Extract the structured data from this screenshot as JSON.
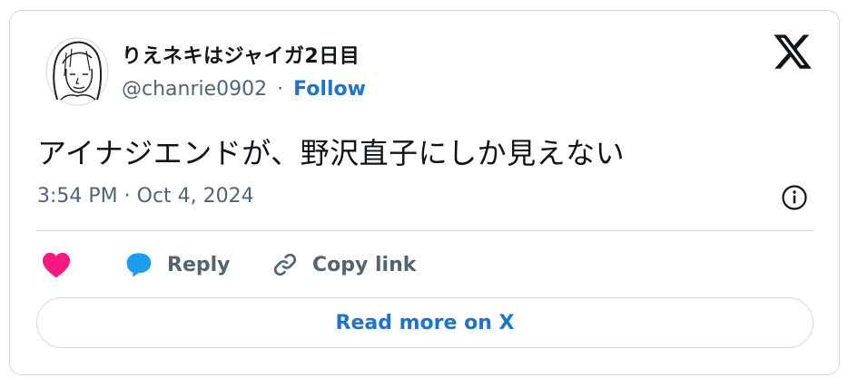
{
  "author": {
    "display_name": "りえネキはジャイガ2日目",
    "handle": "@chanrie0902",
    "separator": "·",
    "follow_label": "Follow",
    "avatar_icon": "sketch-portrait-avatar"
  },
  "logo_icon": "x-logo-icon",
  "tweet": {
    "text": "アイナジエンドが、野沢直子にしか見えない",
    "timestamp": "3:54 PM · Oct 4, 2024"
  },
  "actions": {
    "like_icon": "heart-icon",
    "reply_label": "Reply",
    "copy_label": "Copy link"
  },
  "read_more_label": "Read more on X",
  "colors": {
    "accent": "#1d74c8",
    "like": "#f91880",
    "reply_icon": "#1d9bf0",
    "muted": "#536471",
    "border": "#cfd9de"
  }
}
